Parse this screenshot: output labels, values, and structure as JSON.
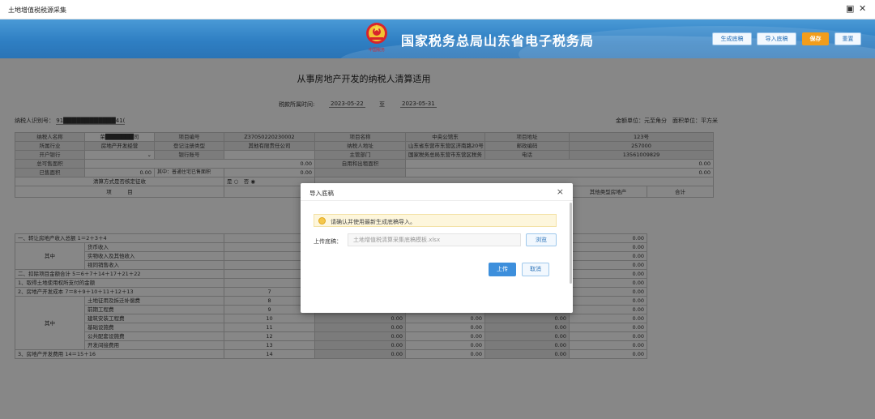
{
  "window": {
    "title": "土地增值税税源采集",
    "restore": "▣",
    "close": "✕"
  },
  "header": {
    "emblem_text": "中国税务",
    "title": "国家税务总局山东省电子税务局",
    "buttons": [
      "生成底稿",
      "导入底稿",
      "保存",
      "重置"
    ]
  },
  "form": {
    "title": "从事房地产开发的纳税人清算适用",
    "period_label": "税款所属时间:",
    "period_start": "2023-05-22",
    "period_to": "至",
    "period_end": "2023-05-31",
    "taxid_label": "纳税人识别号：",
    "taxid_value": "91████████████41(",
    "units": "金额单位：元至角分　面积单位：平方米",
    "info": {
      "r1": [
        "纳税人名称",
        "荣███████司",
        "项目编号",
        "Z37050220230002",
        "项目名称",
        "中央公馆东",
        "项目地址",
        "123号"
      ],
      "r2": [
        "所属行业",
        "房地产开发经营",
        "登记注册类型",
        "其他有限责任公司",
        "纳税人地址",
        "山东省东营市东营区济南路20号",
        "邮政编码",
        "257000"
      ],
      "r3": [
        "开户银行",
        "",
        "银行账号",
        "",
        "主管部门",
        "国家税务总局东营市东营区税务",
        "电话",
        "13561009829"
      ],
      "r4": [
        "总可售面积",
        "0.00",
        "自用和出租面积",
        "0.00"
      ],
      "r5": [
        "已售面积",
        "0.00",
        "其中：普通住宅已售面积",
        "0.00",
        "0.00"
      ],
      "r6": [
        "清算方式是否核定征收",
        "是",
        "否"
      ]
    },
    "table_head": {
      "item": "项　　　目",
      "other": "其他类型房地产",
      "total": "合计"
    },
    "rows": [
      {
        "a": "一、转让房地产收入总额 1＝2＋3＋4",
        "n": "",
        "v1": "",
        "v2": "",
        "v3": "0.00",
        "v4": "0.00"
      },
      {
        "a": "货币收入",
        "n": "",
        "v1": "",
        "v2": "",
        "v3": "0.00",
        "v4": "0.00"
      },
      {
        "a": "实物收入及其他收入",
        "n": "",
        "v1": "",
        "v2": "",
        "v3": "0.00",
        "v4": "0.00"
      },
      {
        "a": "视同销售收入",
        "n": "",
        "v1": "",
        "v2": "",
        "v3": "0.00",
        "v4": "0.00"
      },
      {
        "a": "二、扣除项目金额合计 5＝6＋7＋14＋17＋21＋22",
        "n": "",
        "v1": "",
        "v2": "",
        "v3": "0.00",
        "v4": "0.00"
      },
      {
        "a": "1、取得土地使用权所支付的金额",
        "n": "",
        "v1": "",
        "v2": "",
        "v3": "0.00",
        "v4": "0.00"
      },
      {
        "a": "2、房地产开发成本 7＝8＋9＋10＋11＋12＋13",
        "n": "7",
        "v1": "0.00",
        "v2": "0.00",
        "v3": "0.00",
        "v4": "0.00"
      },
      {
        "a": "土地征用及拆迁补偿费",
        "n": "8",
        "v1": "0.00",
        "v2": "0.00",
        "v3": "0.00",
        "v4": "0.00"
      },
      {
        "a": "前期工程费",
        "n": "9",
        "v1": "0.00",
        "v2": "0.00",
        "v3": "0.00",
        "v4": "0.00"
      },
      {
        "a": "建筑安装工程费",
        "n": "10",
        "v1": "0.00",
        "v2": "0.00",
        "v3": "0.00",
        "v4": "0.00"
      },
      {
        "a": "基础设施费",
        "n": "11",
        "v1": "0.00",
        "v2": "0.00",
        "v3": "0.00",
        "v4": "0.00"
      },
      {
        "a": "公共配套设施费",
        "n": "12",
        "v1": "0.00",
        "v2": "0.00",
        "v3": "0.00",
        "v4": "0.00"
      },
      {
        "a": "开发间接费用",
        "n": "13",
        "v1": "0.00",
        "v2": "0.00",
        "v3": "0.00",
        "v4": "0.00"
      },
      {
        "a": "3、房地产开发费用 14＝15＋16",
        "n": "14",
        "v1": "0.00",
        "v2": "0.00",
        "v3": "0.00",
        "v4": "0.00"
      }
    ],
    "qizhong": "其中"
  },
  "modal": {
    "title": "导入底稿",
    "close": "×",
    "notice": "请确认并使用最新生成底稿导入。",
    "file_label": "上传底稿：",
    "file_placeholder": "土地增值税清算采集底稿模板.xlsx",
    "browse": "浏览",
    "upload": "上传",
    "cancel": "取消"
  },
  "colors": {
    "header_blue": "#2f7fc3",
    "save_orange": "#f29d1b",
    "primary_blue": "#3d8fdc"
  }
}
